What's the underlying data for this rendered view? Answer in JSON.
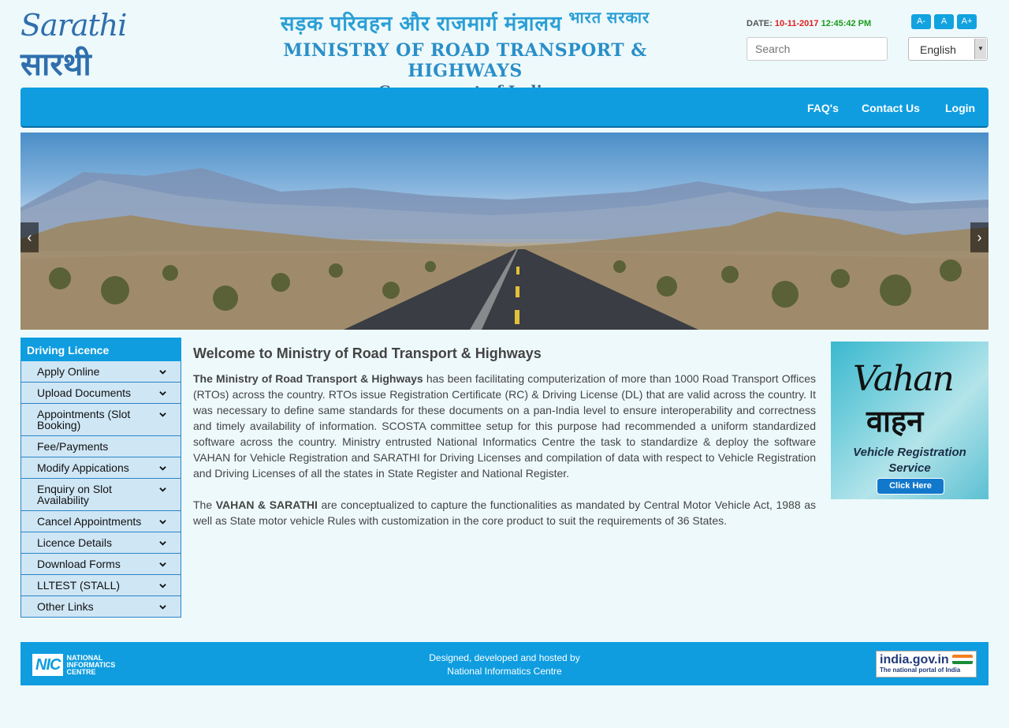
{
  "header": {
    "logo_en": "Sarathi",
    "logo_hi": "सारथी",
    "ministry_hindi": "सड़क परिवहन और राजमार्ग मंत्रालय",
    "ministry_hindi_sup": "भारत सरकार",
    "ministry_english": "MINISTRY OF ROAD TRANSPORT & HIGHWAYS",
    "government": "Government of India",
    "date_label": "DATE:",
    "date": "10-11-2017",
    "time": "12:45:42 PM",
    "font_small": "A-",
    "font_normal": "A",
    "font_large": "A+",
    "search_placeholder": "Search",
    "language": "English"
  },
  "nav": {
    "faqs": "FAQ's",
    "contact": "Contact Us",
    "login": "Login"
  },
  "carousel": {
    "prev": "‹",
    "next": "›"
  },
  "sidebar": {
    "title": "Driving Licence",
    "items": [
      {
        "label": "Apply Online",
        "has_submenu": true
      },
      {
        "label": "Upload Documents",
        "has_submenu": true
      },
      {
        "label": "Appointments (Slot Booking)",
        "has_submenu": true
      },
      {
        "label": "Fee/Payments",
        "has_submenu": false
      },
      {
        "label": "Modify Appications",
        "has_submenu": true
      },
      {
        "label": "Enquiry on Slot Availability",
        "has_submenu": true
      },
      {
        "label": "Cancel Appointments",
        "has_submenu": true
      },
      {
        "label": "Licence Details",
        "has_submenu": true
      },
      {
        "label": "Download Forms",
        "has_submenu": true
      },
      {
        "label": "LLTEST (STALL)",
        "has_submenu": true
      },
      {
        "label": "Other Links",
        "has_submenu": true
      }
    ]
  },
  "main": {
    "heading": "Welcome to Ministry of Road Transport & Highways",
    "p1_bold": "The Ministry of Road Transport & Highways",
    "p1_rest": " has been facilitating computerization of more than 1000 Road Transport Offices (RTOs) across the country. RTOs issue Registration Certificate (RC) & Driving License (DL) that are valid across the country. It was necessary to define same standards for these documents on a pan-India level to ensure interoperability and correctness and timely availability of information. SCOSTA committee setup for this purpose had recommended a uniform standardized software across the country. Ministry entrusted National Informatics Centre the task to standardize & deploy the software VAHAN for Vehicle Registration and SARATHI for Driving Licenses and compilation of data with respect to Vehicle Registration and Driving Licenses of all the states in State Register and National Register.",
    "p2_pre": "The ",
    "p2_bold": "VAHAN & SARATHI",
    "p2_rest": " are conceptualized to capture the functionalities as mandated by Central Motor Vehicle Act, 1988 as well as State motor vehicle Rules with customization in the core product to suit the requirements of 36 States."
  },
  "vahan_ad": {
    "title_en": "Vahan",
    "title_hi": "वाहन",
    "subtitle_1": "Vehicle Registration",
    "subtitle_2": "Service",
    "button": "Click Here"
  },
  "footer": {
    "nic_mark": "NIC",
    "nic_line1": "NATIONAL",
    "nic_line2": "INFORMATICS",
    "nic_line3": "CENTRE",
    "line1": "Designed, developed and hosted by",
    "line2": "National Informatics Centre",
    "india_gov": "india.gov.in",
    "india_gov_tag": "The national portal of India"
  },
  "colors": {
    "primary_blue": "#0f9de0",
    "date_red": "#e02020",
    "time_green": "#1a9a1a",
    "sidebar_bg": "#cfe6f5"
  }
}
